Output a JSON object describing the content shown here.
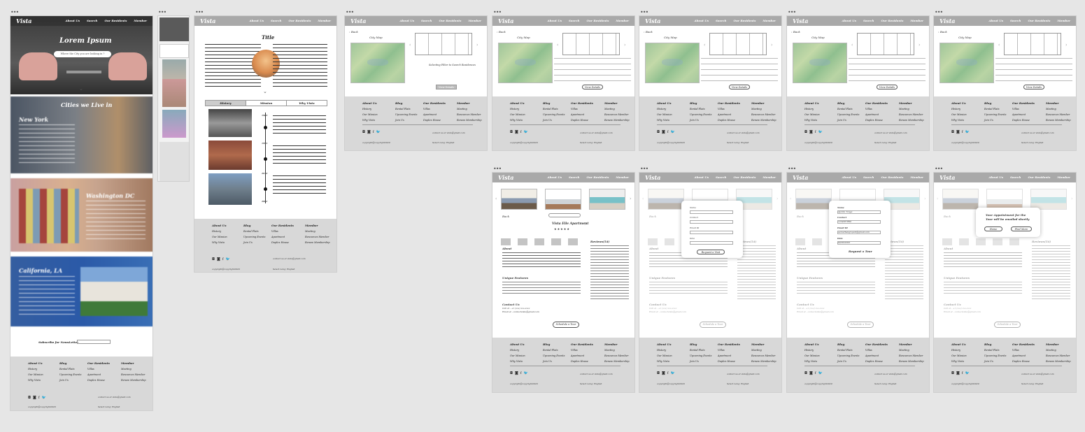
{
  "brand": "Vista",
  "nav_links": [
    "About Us",
    "Search",
    "Our Residents",
    "Member"
  ],
  "nav_links_alt": [
    "About Us",
    "Search",
    "Our Residents",
    "Member"
  ],
  "home": {
    "hero_title": "Lorem Ipsum",
    "search_placeholder": "Where the City you are looking in ?",
    "section_title": "Cities we Live in",
    "cities": [
      "New York",
      "Washington DC",
      "California, LA"
    ],
    "subscribe": "Subscribe for NewsLetter"
  },
  "about": {
    "title": "Title",
    "tabs": [
      "History",
      "Mission",
      "Why Vista"
    ],
    "years": [
      "1989",
      "1995",
      "2010",
      "2002"
    ]
  },
  "search": {
    "back": "Back",
    "city_map": "City Map",
    "placeholder_text": "Selecting Filter to Search Residences",
    "view_button": "View Details"
  },
  "footer": {
    "cols": [
      [
        "About Us",
        "History",
        "Our Mission",
        "Why Vista"
      ],
      [
        "Blog",
        "Rental Flats",
        "Upcoming Events",
        "Join Us"
      ],
      [
        "Our Residents",
        "Villas",
        "Apartment",
        "Duplex House"
      ],
      [
        "Member",
        "Meeting",
        "Resources Member",
        "Renew Membership"
      ]
    ],
    "copyright": "copyright@copyright2020",
    "contact": "contact us at vista@gmail.com",
    "select_lang": "Select Lang: English",
    "social": [
      "instagram-icon",
      "facebook-icon",
      "twitter-icon"
    ]
  },
  "detail": {
    "title": "Vista Elle Apartment",
    "about": "About",
    "amenities": "Unique Features",
    "contact": "Contact Us",
    "reviews": "Reviews(54)",
    "schedule": "Schedule a Tour",
    "contact_call": "Call at - +1 (xxx) xxx-xxxx",
    "contact_email": "Email at - contactvista@gmail.com"
  },
  "form1": {
    "labels": [
      "Name",
      "Contact",
      "Email ID",
      "Date"
    ],
    "button": "Request a Visit"
  },
  "form2": {
    "labels": [
      "Name",
      "Contact",
      "Email ID",
      "Date"
    ],
    "values": [
      "Aprilia Tonga",
      "1234567890",
      "aaravthangrapoli@gmail.com",
      "04/03/2022"
    ],
    "button": "Request a Tour"
  },
  "confirm": {
    "message": "Your Appointment for the Tour will be emailed shortly",
    "buttons": [
      "Home",
      "Find More"
    ]
  },
  "colors": {
    "nav": "#a9a9a9",
    "footer": "#d8d8d8",
    "canvas": "#e6e6e6"
  }
}
